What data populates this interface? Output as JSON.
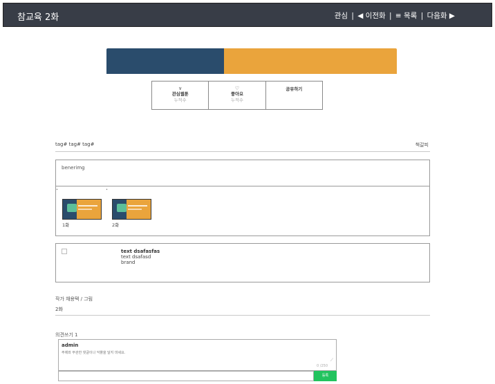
{
  "header": {
    "title": "참교육  2화",
    "nav": {
      "interest": "관심",
      "sep1": "|",
      "prev": "◀ 이전화",
      "sep2": "|",
      "list": "≡ 목록",
      "sep3": "|",
      "next": "다음화 ▶"
    }
  },
  "colors": {
    "topbar": "#383d47",
    "banner_blue": "#2a4c6c",
    "banner_orange": "#eaa43c",
    "submit_green": "#22c35e"
  },
  "actions": [
    {
      "icon": "∨",
      "label": "관심웹툰",
      "sub": "누적수"
    },
    {
      "icon": "♡",
      "label": "좋아요",
      "sub": "누적수"
    },
    {
      "icon": "",
      "label": "공유하기",
      "sub": ""
    }
  ],
  "tags": "tag# tag# tag#",
  "bookmark": "책갈피",
  "episodes_box": {
    "banner_alt": "benerimg",
    "dot1": "•",
    "dot2": "•",
    "episodes": [
      {
        "caption": "1화"
      },
      {
        "caption": "2화"
      }
    ]
  },
  "info_box": {
    "line1": "text dsafasfas",
    "line2": "text dsafasd",
    "line3": "brand"
  },
  "author_line": "작가 채용택 / 그림",
  "episode_line": "2화",
  "comments": {
    "title": "의견쓰기 1",
    "user": "admin",
    "placeholder": "주제와 무관한 댓글이나 악플을 달지 마세요.",
    "counter": "0 /250",
    "grip": "⟋",
    "submit": "등록"
  }
}
